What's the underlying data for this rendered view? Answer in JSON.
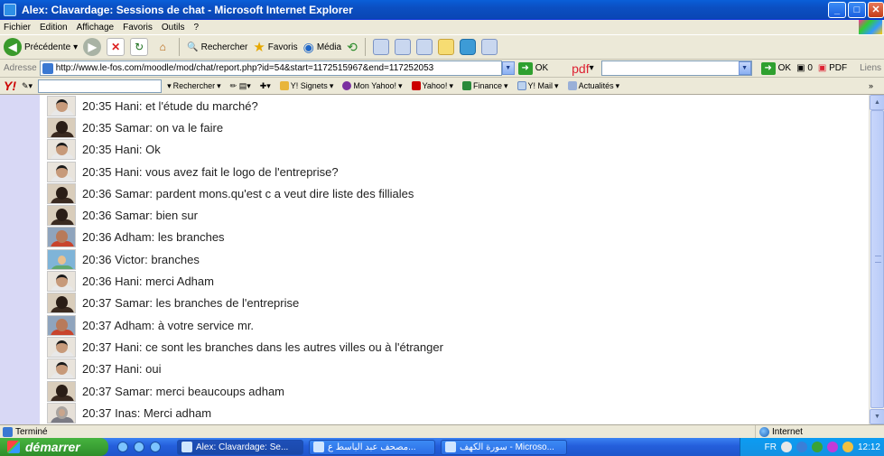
{
  "window": {
    "title": "Alex: Clavardage: Sessions de chat - Microsoft Internet Explorer"
  },
  "menu": [
    "Fichier",
    "Edition",
    "Affichage",
    "Favoris",
    "Outils",
    "?"
  ],
  "toolbar": {
    "back_label": "Précédente",
    "search_label": "Rechercher",
    "favorites_label": "Favoris",
    "media_label": "Média"
  },
  "address": {
    "label": "Adresse",
    "url": "http://www.le-fos.com/moodle/mod/chat/report.php?id=54&start=1172515967&end=117252053",
    "go_label": "OK",
    "pdf_logo": "pdf",
    "right_go_label": "OK",
    "counter": "0",
    "pdf_label": "PDF",
    "links_label": "Liens"
  },
  "yahoo": {
    "search_label": "Rechercher",
    "items": [
      "Y! Signets",
      "Mon Yahoo!",
      "Yahoo!",
      "Finance",
      "Y! Mail",
      "Actualités"
    ]
  },
  "chat": {
    "lines": [
      {
        "avatar": "hani",
        "text": "20:35 Hani: et l'étude du marché?"
      },
      {
        "avatar": "samar",
        "text": "20:35 Samar: on va le faire"
      },
      {
        "avatar": "hani",
        "text": "20:35 Hani: Ok"
      },
      {
        "avatar": "hani",
        "text": "20:35 Hani: vous avez fait le logo de l'entreprise?"
      },
      {
        "avatar": "samar",
        "text": "20:36 Samar: pardent mons.qu'est c a veut dire liste des filliales"
      },
      {
        "avatar": "samar",
        "text": "20:36 Samar: bien sur"
      },
      {
        "avatar": "adham",
        "text": "20:36 Adham: les branches"
      },
      {
        "avatar": "victor",
        "text": "20:36 Victor: branches"
      },
      {
        "avatar": "hani",
        "text": "20:36 Hani: merci Adham"
      },
      {
        "avatar": "samar",
        "text": "20:37 Samar: les branches de l'entreprise"
      },
      {
        "avatar": "adham",
        "text": "20:37 Adham: à votre service mr."
      },
      {
        "avatar": "hani",
        "text": "20:37 Hani: ce sont les branches dans les autres villes ou à l'étranger"
      },
      {
        "avatar": "hani",
        "text": "20:37 Hani: oui"
      },
      {
        "avatar": "samar",
        "text": "20:37 Samar: merci beaucoups adham"
      },
      {
        "avatar": "inas",
        "text": "20:37 Inas: Merci adham"
      },
      {
        "avatar": "samar",
        "text": ""
      }
    ]
  },
  "status": {
    "left": "Terminé",
    "zone": "Internet"
  },
  "taskbar": {
    "start_label": "démarrer",
    "tasks": [
      "Alex: Clavardage: Se...",
      "مصحف عبد الباسط ع...",
      "سورة الكهف - Microso..."
    ],
    "lang": "FR",
    "clock": "12:12"
  },
  "colors": {
    "titlebar": "#0a5fd8",
    "chrome": "#ece9d8",
    "left_strip": "#d8d8f5",
    "taskbar": "#245edb",
    "start": "#3aa336"
  }
}
